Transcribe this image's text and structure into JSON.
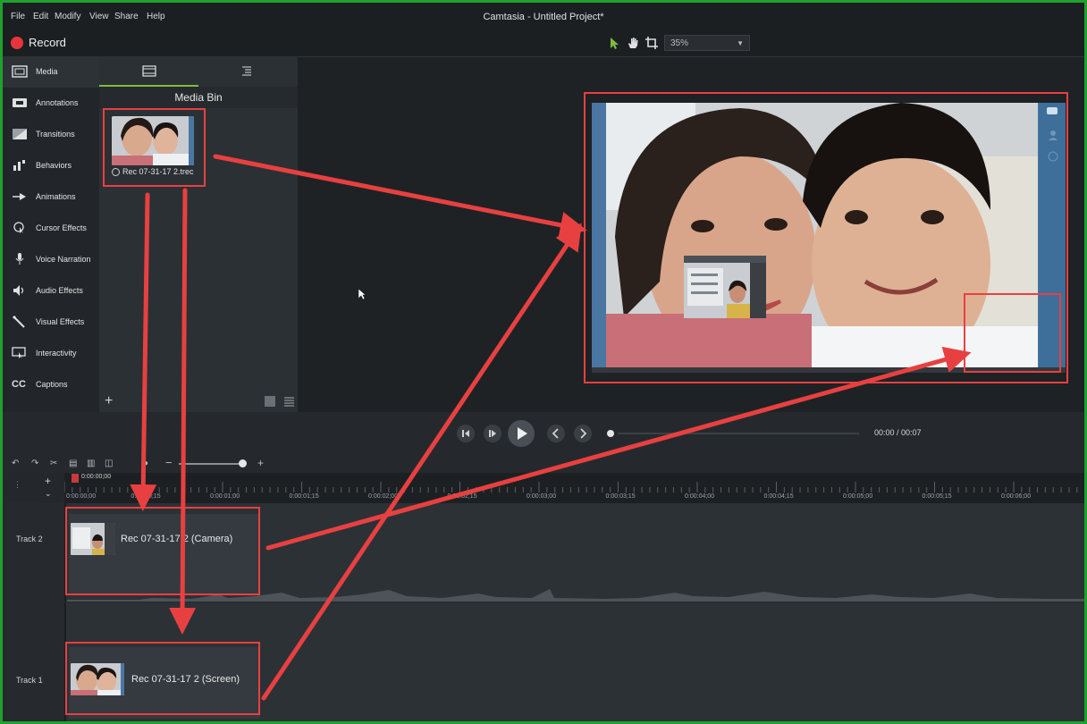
{
  "menu": {
    "items": [
      "File",
      "Edit",
      "Modify",
      "View",
      "Share",
      "Help"
    ],
    "title": "Camtasia - Untitled Project*"
  },
  "toolbar": {
    "record_label": "Record",
    "zoom": "35%"
  },
  "tools": [
    {
      "label": "Media",
      "icon": "media-icon"
    },
    {
      "label": "Annotations",
      "icon": "annotations-icon"
    },
    {
      "label": "Transitions",
      "icon": "transitions-icon"
    },
    {
      "label": "Behaviors",
      "icon": "behaviors-icon"
    },
    {
      "label": "Animations",
      "icon": "animations-icon"
    },
    {
      "label": "Cursor Effects",
      "icon": "cursor-effects-icon"
    },
    {
      "label": "Voice Narration",
      "icon": "microphone-icon"
    },
    {
      "label": "Audio Effects",
      "icon": "speaker-icon"
    },
    {
      "label": "Visual Effects",
      "icon": "magic-wand-icon"
    },
    {
      "label": "Interactivity",
      "icon": "interactivity-icon"
    },
    {
      "label": "Captions",
      "icon": "cc-icon"
    }
  ],
  "media_bin": {
    "header": "Media Bin",
    "clip_name": "Rec 07-31-17 2.trec",
    "add_label": "+"
  },
  "playback": {
    "time": "00:00  /  00:07"
  },
  "timeline": {
    "playhead_time": "0:00:00;00",
    "ruler_labels": [
      "0:00:00;00",
      "0:00:00;15",
      "0:00:01;00",
      "0:00:01;15",
      "0:00:02;00",
      "0:00:02;15",
      "0:00:03;00",
      "0:00:03;15",
      "0:00:04;00",
      "0:00:04;15",
      "0:00:05;00",
      "0:00:05;15",
      "0:00:06;00"
    ],
    "tracks": [
      {
        "name": "Track 2",
        "clip": "Rec 07-31-17 2 (Camera)"
      },
      {
        "name": "Track 1",
        "clip": "Rec 07-31-17 2 (Screen)"
      }
    ]
  },
  "colors": {
    "accent_green": "#7dbd3b",
    "record_red": "#e8353b",
    "annotation_red": "#e84040",
    "frame_border": "#1fa12e"
  }
}
